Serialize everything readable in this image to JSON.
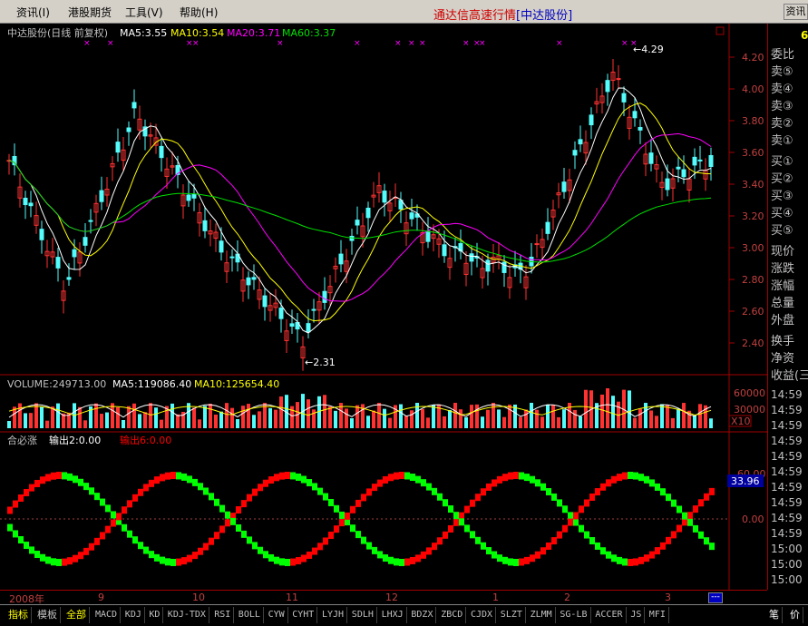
{
  "menu": {
    "items": [
      "资讯(I)",
      "港股期货",
      "工具(V)",
      "帮助(H)"
    ],
    "title_prefix": "通达信高速行情",
    "title_stock": "[中达股份]",
    "info_button": "资讯"
  },
  "price_panel": {
    "header": {
      "name": "中达股份(日线 前复权)",
      "ma5": "MA5:3.55",
      "ma10": "MA10:3.54",
      "ma20": "MA20:3.71",
      "ma60": "MA60:3.37"
    },
    "y_ticks": [
      "4.20",
      "4.00",
      "3.80",
      "3.60",
      "3.40",
      "3.20",
      "3.00",
      "2.80",
      "2.60",
      "2.40"
    ],
    "annotations": {
      "high": "4.29",
      "low": "2.31"
    }
  },
  "volume_panel": {
    "header": {
      "volume": "VOLUME:249713.00",
      "ma5": "MA5:119086.40",
      "ma10": "MA10:125654.40"
    },
    "y_ticks": [
      "60000",
      "30000"
    ],
    "unit": "X10"
  },
  "indicator_panel": {
    "header": {
      "name": "合必涨",
      "out2": "输出2:0.00",
      "out6": "输出6:0.00"
    },
    "y_ticks": [
      "60.00",
      "0.00"
    ],
    "current_value": "33.96"
  },
  "date_axis": {
    "year": "2008年",
    "months": [
      "9",
      "10",
      "11",
      "12",
      "1",
      "2",
      "3"
    ]
  },
  "quote_panel": {
    "top_number": "6",
    "labels": [
      "委比",
      "卖⑤",
      "卖④",
      "卖③",
      "卖②",
      "卖①",
      "买①",
      "买②",
      "买③",
      "买④",
      "买⑤",
      "现价",
      "涨跌",
      "涨幅",
      "总量",
      "外盘",
      "换手",
      "净资",
      "收益(三"
    ],
    "times": [
      "14:59",
      "14:59",
      "14:59",
      "14:59",
      "14:59",
      "14:59",
      "14:59",
      "14:59",
      "14:59",
      "14:59",
      "15:00",
      "15:00",
      "15:00",
      "15:00"
    ],
    "period": "日线"
  },
  "tabs": {
    "items": [
      "指标",
      "模板",
      "全部",
      "MACD",
      "KDJ",
      "KD",
      "KDJ-TDX",
      "RSI",
      "BOLL",
      "CYW",
      "CYHT",
      "LYJH",
      "SDLH",
      "LHXJ",
      "BDZX",
      "ZBCD",
      "CJDX",
      "SLZT",
      "ZLMM",
      "SG-LB",
      "ACCER",
      "JS",
      "MFI"
    ],
    "right": [
      "笔",
      "价"
    ]
  },
  "colors": {
    "up": "#ff3232",
    "down": "#54fcfc",
    "ma5": "#ffffff",
    "ma10": "#ffff00",
    "ma20": "#ff00ff",
    "ma60": "#00e000",
    "axis": "#a00000",
    "indicator_red": "#ff0000",
    "indicator_green": "#00ff00"
  }
}
